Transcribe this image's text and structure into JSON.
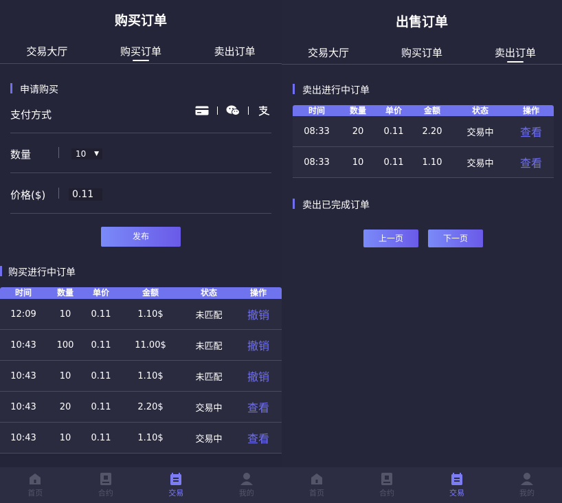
{
  "left": {
    "title": "购买订单",
    "tabs": [
      "交易大厅",
      "购买订单",
      "卖出订单"
    ],
    "active_tab": 1,
    "apply_section": "申请购买",
    "pay_label": "支付方式",
    "qty_label": "数量",
    "qty_value": "10",
    "price_label": "价格($)",
    "price_value": "0.11",
    "publish_button": "发布",
    "ongoing_section": "购买进行中订单",
    "columns": [
      "时间",
      "数量",
      "单价",
      "金额",
      "状态",
      "操作"
    ],
    "rows": [
      {
        "time": "12:09",
        "qty": "10",
        "price": "0.11",
        "amount": "1.10$",
        "status": "未匹配",
        "action": "撤销"
      },
      {
        "time": "10:43",
        "qty": "100",
        "price": "0.11",
        "amount": "11.00$",
        "status": "未匹配",
        "action": "撤销"
      },
      {
        "time": "10:43",
        "qty": "10",
        "price": "0.11",
        "amount": "1.10$",
        "status": "未匹配",
        "action": "撤销"
      },
      {
        "time": "10:43",
        "qty": "20",
        "price": "0.11",
        "amount": "2.20$",
        "status": "交易中",
        "action": "查看"
      },
      {
        "time": "10:43",
        "qty": "10",
        "price": "0.11",
        "amount": "1.10$",
        "status": "交易中",
        "action": "查看"
      }
    ]
  },
  "right": {
    "title": "出售订单",
    "tabs": [
      "交易大厅",
      "购买订单",
      "卖出订单"
    ],
    "active_tab": 2,
    "ongoing_section": "卖出进行中订单",
    "columns": [
      "时间",
      "数量",
      "单价",
      "金额",
      "状态",
      "操作"
    ],
    "rows": [
      {
        "time": "08:33",
        "qty": "20",
        "price": "0.11",
        "amount": "2.20",
        "status": "交易中",
        "action": "查看"
      },
      {
        "time": "08:33",
        "qty": "10",
        "price": "0.11",
        "amount": "1.10",
        "status": "交易中",
        "action": "查看"
      }
    ],
    "done_section": "卖出已完成订单",
    "prev_button": "上一页",
    "next_button": "下一页"
  },
  "nav": [
    {
      "label": "首页",
      "icon": "home-icon"
    },
    {
      "label": "合约",
      "icon": "contract-icon"
    },
    {
      "label": "交易",
      "icon": "trade-icon"
    },
    {
      "label": "我的",
      "icon": "user-icon"
    }
  ],
  "nav_active": 2,
  "colors": {
    "accent": "#6f6ff0",
    "background": "#25253a",
    "nav_inactive": "#55556a"
  }
}
